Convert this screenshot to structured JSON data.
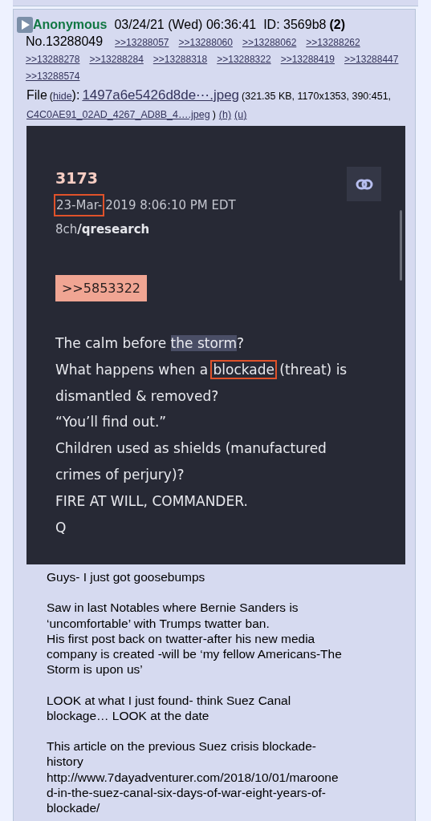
{
  "post": {
    "name": "Anonymous",
    "datetime": "03/24/21 (Wed) 06:36:41",
    "id": "ID: 3569b8",
    "id_count": "(2)",
    "number": "No.13288049",
    "replies": [
      ">>13288057",
      ">>13288060",
      ">>13288062",
      ">>13288262",
      ">>13288278",
      ">>13288284",
      ">>13288318",
      ">>13288322",
      ">>13288419",
      ">>13288447",
      ">>13288574"
    ],
    "file": [
      {
        "kind": "label",
        "text": "File"
      },
      {
        "kind": "text",
        "text": "("
      },
      {
        "kind": "link",
        "text": "hide"
      },
      {
        "kind": "label",
        "text": "):"
      },
      {
        "kind": "filename",
        "text": "1497a6e5426d8de⋯.jpeg"
      },
      {
        "kind": "text",
        "text": "(321.35 KB, 1170x1353, 390:451,"
      },
      {
        "kind": "break"
      },
      {
        "kind": "link",
        "text": "C4C0AE91_02AD_4267_AD8B_4….jpeg"
      },
      {
        "kind": "text",
        "text": ")"
      },
      {
        "kind": "link",
        "text": "(h)"
      },
      {
        "kind": "link",
        "text": "(u)"
      }
    ],
    "image": {
      "title": "3173",
      "date": [
        {
          "text": "23-Mar-",
          "boxed": true
        },
        {
          "text": "2019 8:06:10 PM EDT",
          "boxed": false
        }
      ],
      "source": "8ch",
      "board": "/qresearch",
      "quote_link": ">>5853322",
      "lines": [
        [
          {
            "text": "The calm before ",
            "highlighted": false,
            "boxed": false
          },
          {
            "text": "the storm",
            "highlighted": true,
            "boxed": false
          },
          {
            "text": "?",
            "highlighted": false,
            "boxed": false
          }
        ],
        [
          {
            "text": "What happens when a ",
            "highlighted": false,
            "boxed": false
          },
          {
            "text": "blockade",
            "highlighted": false,
            "boxed": true
          },
          {
            "text": " (threat) is",
            "highlighted": false,
            "boxed": false
          }
        ],
        [
          {
            "text": "dismantled & removed?",
            "highlighted": false,
            "boxed": false
          }
        ],
        [
          {
            "text": "“You’ll find out.”",
            "highlighted": false,
            "boxed": false
          }
        ],
        [
          {
            "text": "Children used as shields (manufactured",
            "highlighted": false,
            "boxed": false
          }
        ],
        [
          {
            "text": "crimes of perjury)?",
            "highlighted": false,
            "boxed": false
          }
        ],
        [
          {
            "text": "FIRE AT WILL, COMMANDER.",
            "highlighted": false,
            "boxed": false
          }
        ],
        [
          {
            "text": "Q",
            "highlighted": false,
            "boxed": false
          }
        ]
      ]
    },
    "body": [
      [
        "Guys- I just got goosebumps"
      ],
      [
        "Saw in last Notables where Bernie Sanders is",
        "‘uncomfortable’ with Trumps twatter ban.",
        "His first post back on twatter-after his new media",
        "company is created -will be ‘my fellow Americans-The",
        "Storm is upon us’"
      ],
      [
        "LOOK at what I just found- think Suez Canal",
        "blockage… LOOK at the date"
      ],
      [
        "This article on the previous Suez crisis blockade-",
        "history",
        "http://www.7dayadventurer.com/2018/10/01/maroone",
        "d-in-the-suez-canal-six-days-of-war-eight-years-of-",
        "blockade/"
      ]
    ]
  }
}
